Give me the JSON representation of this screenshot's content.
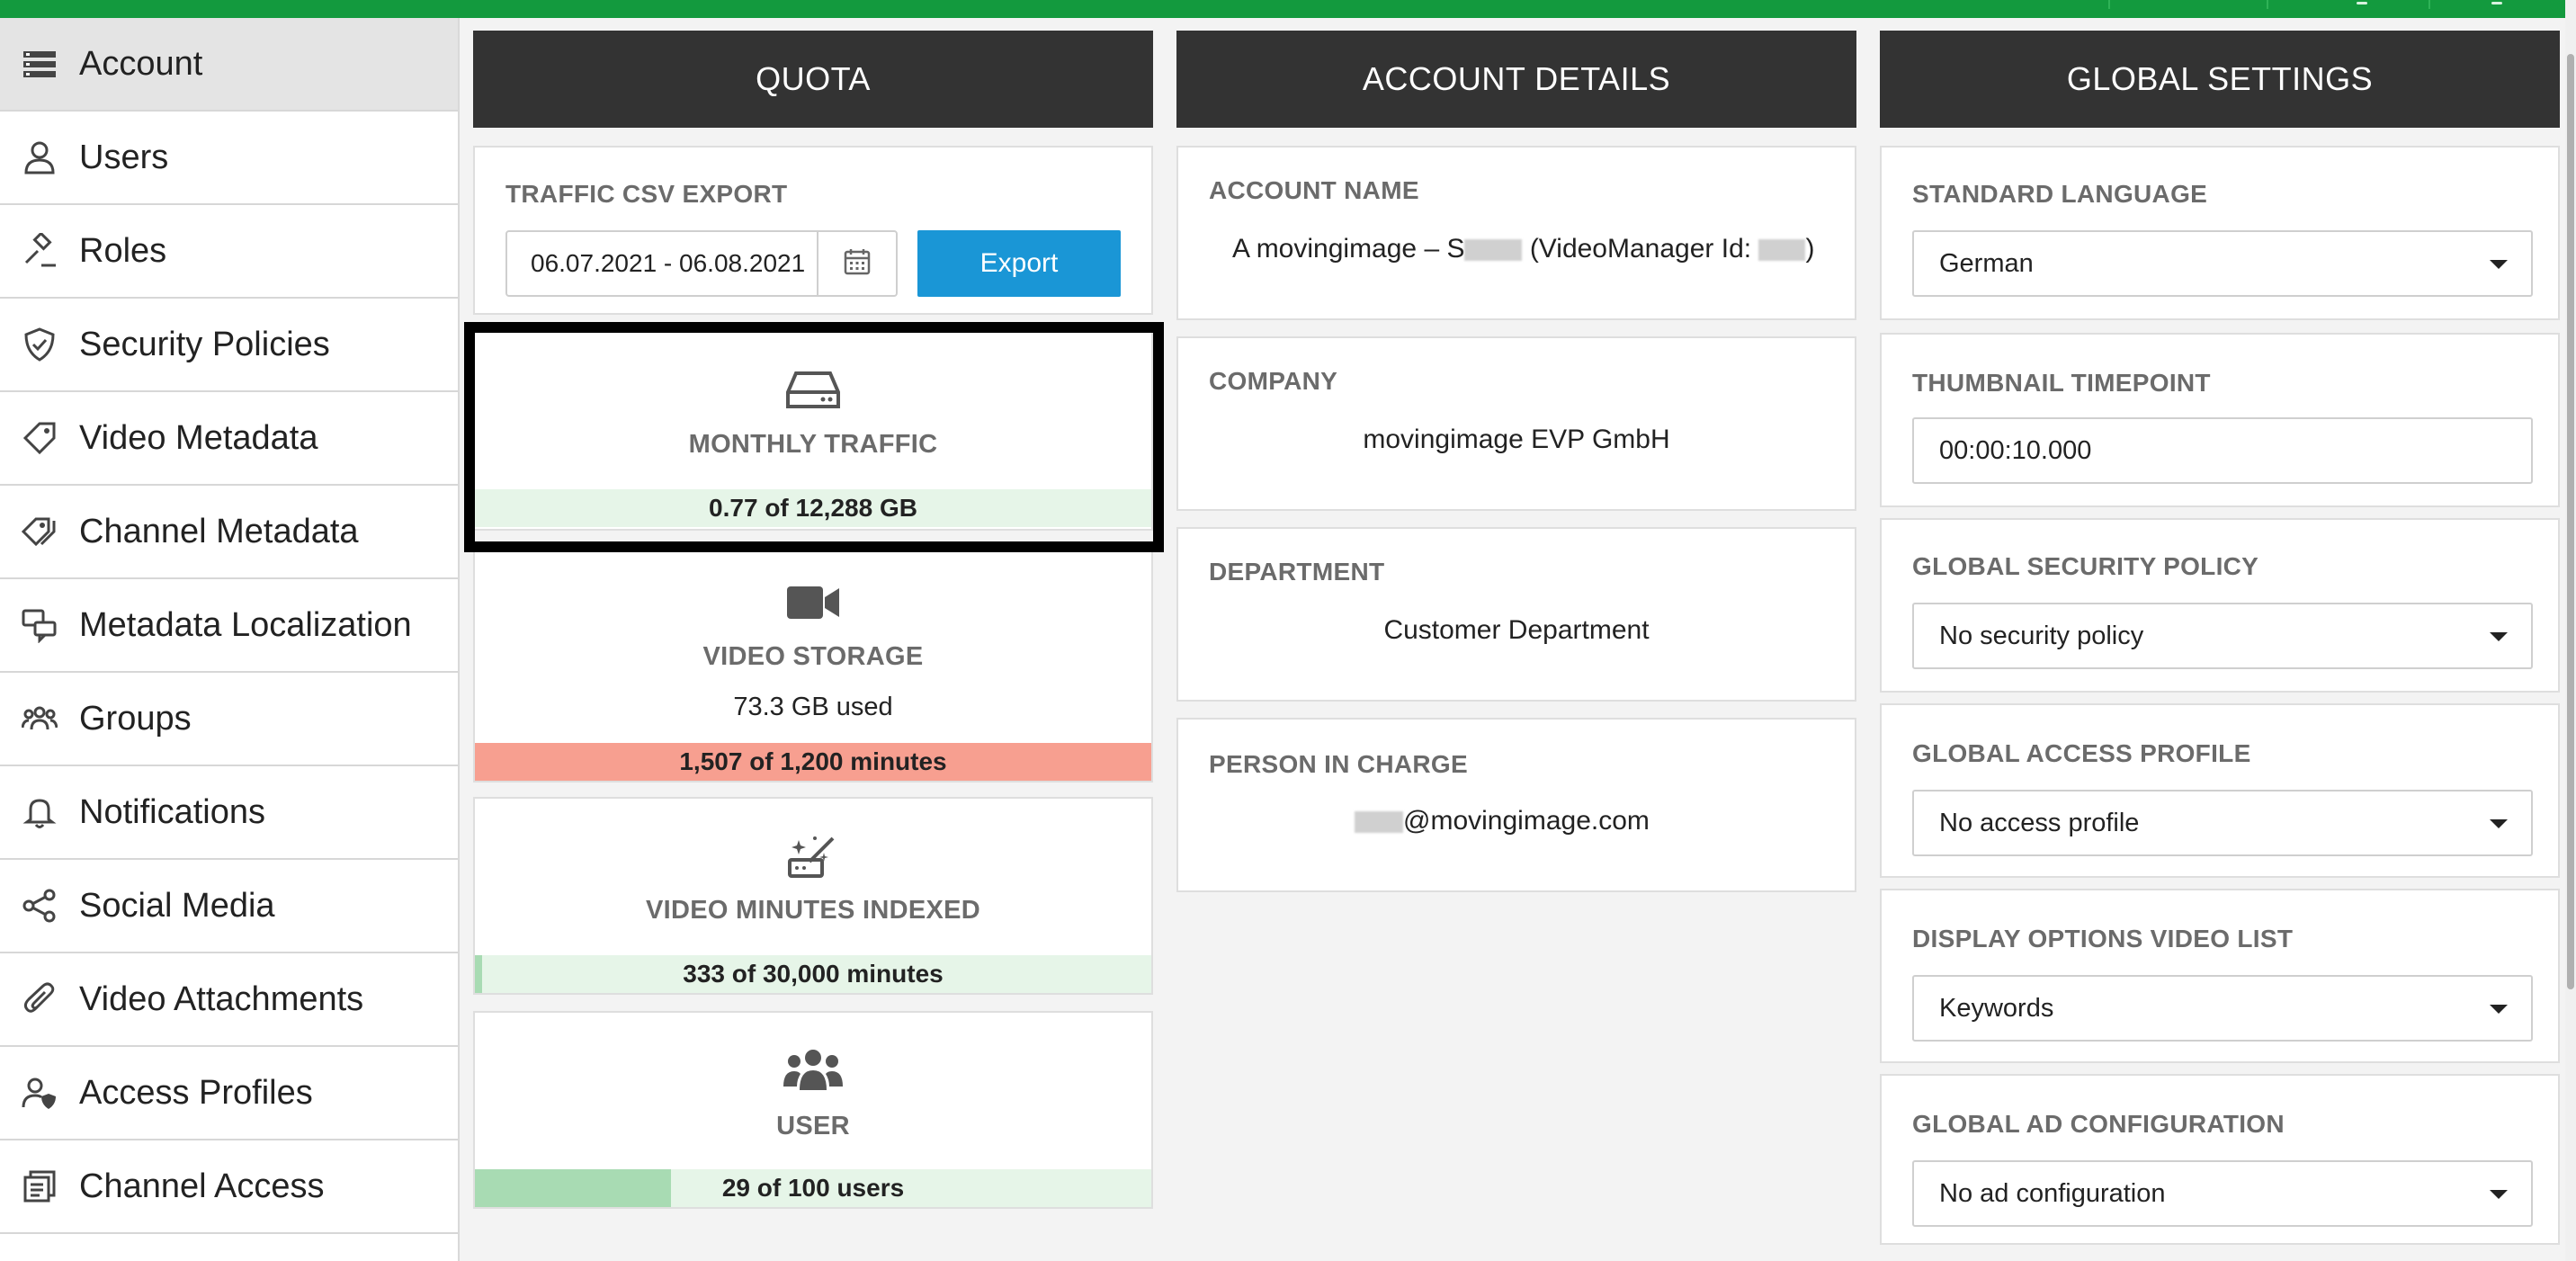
{
  "sidebar": {
    "items": [
      {
        "label": "Account",
        "icon": "account-list-icon"
      },
      {
        "label": "Users",
        "icon": "user-icon"
      },
      {
        "label": "Roles",
        "icon": "gavel-icon"
      },
      {
        "label": "Security Policies",
        "icon": "shield-icon"
      },
      {
        "label": "Video Metadata",
        "icon": "tag-icon"
      },
      {
        "label": "Channel Metadata",
        "icon": "tags-icon"
      },
      {
        "label": "Metadata Localization",
        "icon": "speech-bubbles-icon"
      },
      {
        "label": "Groups",
        "icon": "group-icon"
      },
      {
        "label": "Notifications",
        "icon": "bell-icon"
      },
      {
        "label": "Social Media",
        "icon": "share-icon"
      },
      {
        "label": "Video Attachments",
        "icon": "paperclip-icon"
      },
      {
        "label": "Access Profiles",
        "icon": "user-shield-icon"
      },
      {
        "label": "Channel Access",
        "icon": "channel-access-icon"
      }
    ]
  },
  "quota": {
    "heading": "QUOTA",
    "export": {
      "label": "TRAFFIC CSV EXPORT",
      "date_range": "06.07.2021 - 06.08.2021",
      "button": "Export"
    },
    "monthly_traffic": {
      "title": "MONTHLY TRAFFIC",
      "bar_text": "0.77 of 12,288 GB",
      "fill_fraction": 0.0001
    },
    "video_storage": {
      "title": "VIDEO STORAGE",
      "sub": "73.3 GB used",
      "bar_text": "1,507 of 1,200 minutes",
      "fill_fraction": 1.0
    },
    "video_minutes_indexed": {
      "title": "VIDEO MINUTES INDEXED",
      "bar_text": "333 of 30,000 minutes",
      "fill_fraction": 0.011
    },
    "user": {
      "title": "USER",
      "bar_text": "29 of 100 users",
      "fill_fraction": 0.29
    }
  },
  "account_details": {
    "heading": "ACCOUNT DETAILS",
    "account_name": {
      "label": "ACCOUNT NAME",
      "value_prefix": "A movingimage – S",
      "value_mid": " (VideoManager Id: ",
      "value_suffix": ")"
    },
    "company": {
      "label": "COMPANY",
      "value": "movingimage EVP GmbH"
    },
    "department": {
      "label": "DEPARTMENT",
      "value": "Customer Department"
    },
    "person_in_charge": {
      "label": "PERSON IN CHARGE",
      "value": "@movingimage.com"
    }
  },
  "global_settings": {
    "heading": "GLOBAL SETTINGS",
    "standard_language": {
      "label": "STANDARD LANGUAGE",
      "value": "German"
    },
    "thumbnail_timepoint": {
      "label": "THUMBNAIL TIMEPOINT",
      "value": "00:00:10.000"
    },
    "global_security_policy": {
      "label": "GLOBAL SECURITY POLICY",
      "value": "No security policy"
    },
    "global_access_profile": {
      "label": "GLOBAL ACCESS PROFILE",
      "value": "No access profile"
    },
    "display_options_video_list": {
      "label": "DISPLAY OPTIONS VIDEO LIST",
      "value": "Keywords"
    },
    "global_ad_configuration": {
      "label": "GLOBAL AD CONFIGURATION",
      "value": "No ad configuration"
    }
  },
  "colors": {
    "topbar": "#139a3e",
    "header": "#333333",
    "export_button": "#1a96d6",
    "bar_ok": "#e6f5e8",
    "bar_fill": "#a8dbb3",
    "bar_over": "#f79f90"
  }
}
